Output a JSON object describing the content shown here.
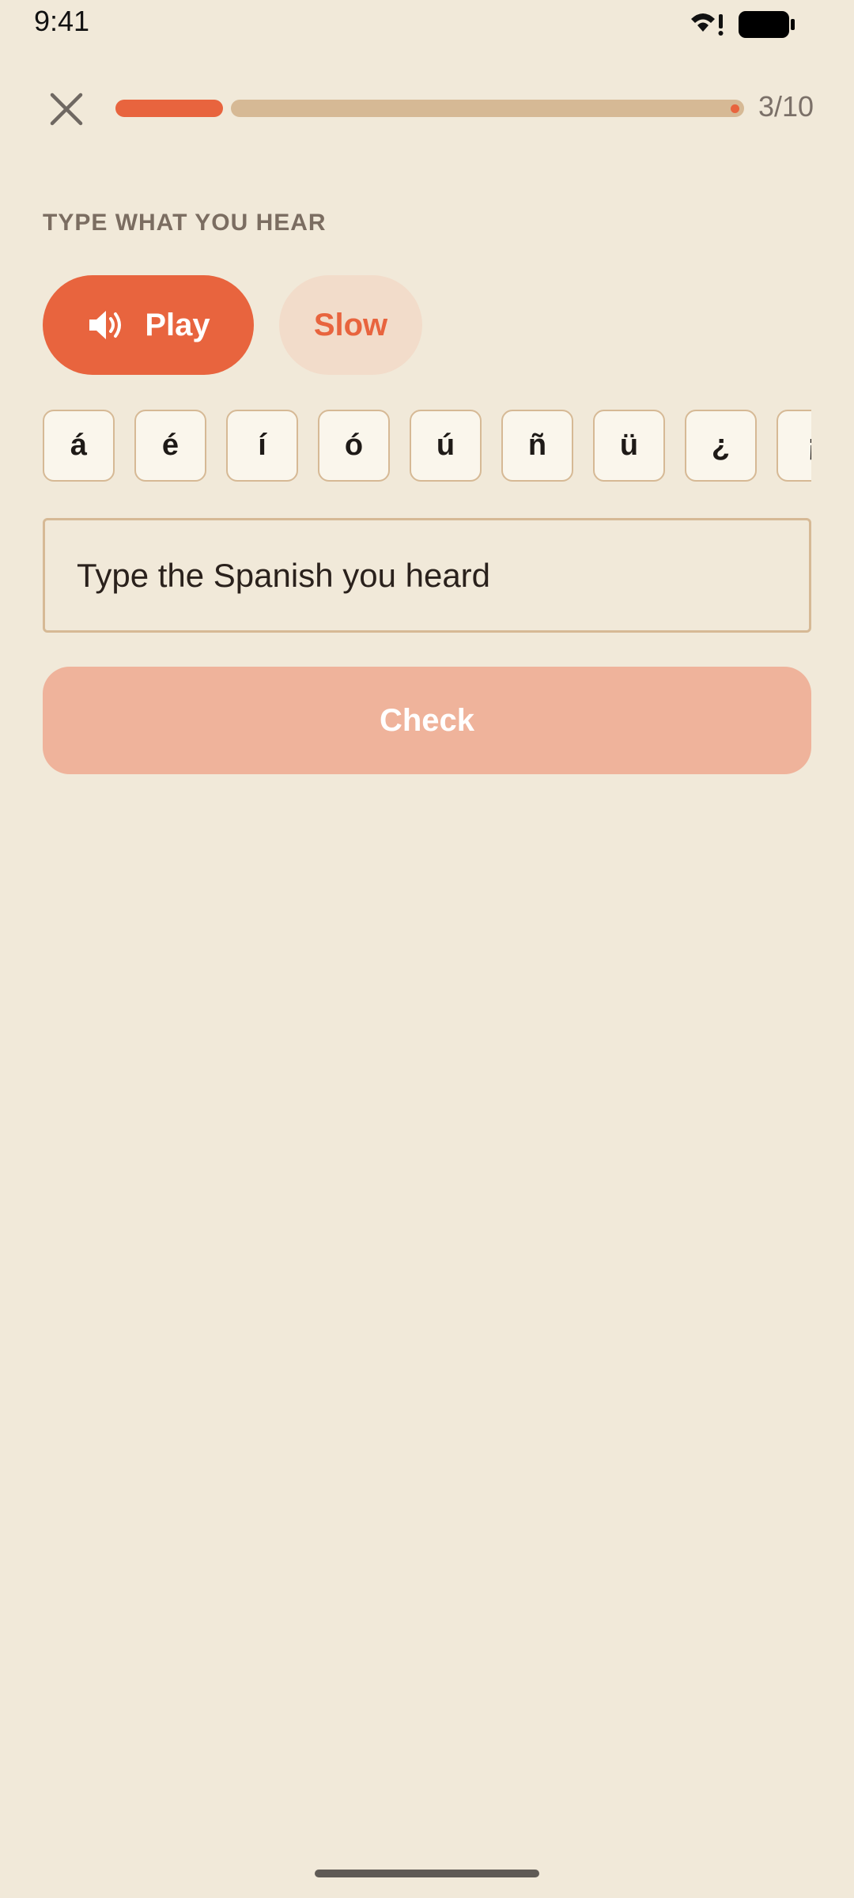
{
  "status_bar": {
    "time": "9:41",
    "wifi_icon": "wifi-alert-icon",
    "battery_icon": "battery-full-icon"
  },
  "header": {
    "close_icon": "close-icon",
    "progress": {
      "current": 3,
      "total": 10,
      "counter_text": "3/10"
    }
  },
  "exercise": {
    "prompt": "TYPE WHAT YOU HEAR",
    "play_label": "Play",
    "play_icon": "speaker-icon",
    "slow_label": "Slow",
    "accent_keys": [
      "á",
      "é",
      "í",
      "ó",
      "ú",
      "ñ",
      "ü",
      "¿",
      "¡"
    ],
    "input": {
      "value": "",
      "placeholder": "Type the Spanish you heard"
    },
    "check_label": "Check"
  },
  "colors": {
    "background": "#F1E9D9",
    "accent": "#E8643E",
    "accent_soft": "#F2DCCA",
    "check_disabled": "#EFB39B",
    "track": "#D6B995",
    "muted_text": "#7B6D61"
  }
}
